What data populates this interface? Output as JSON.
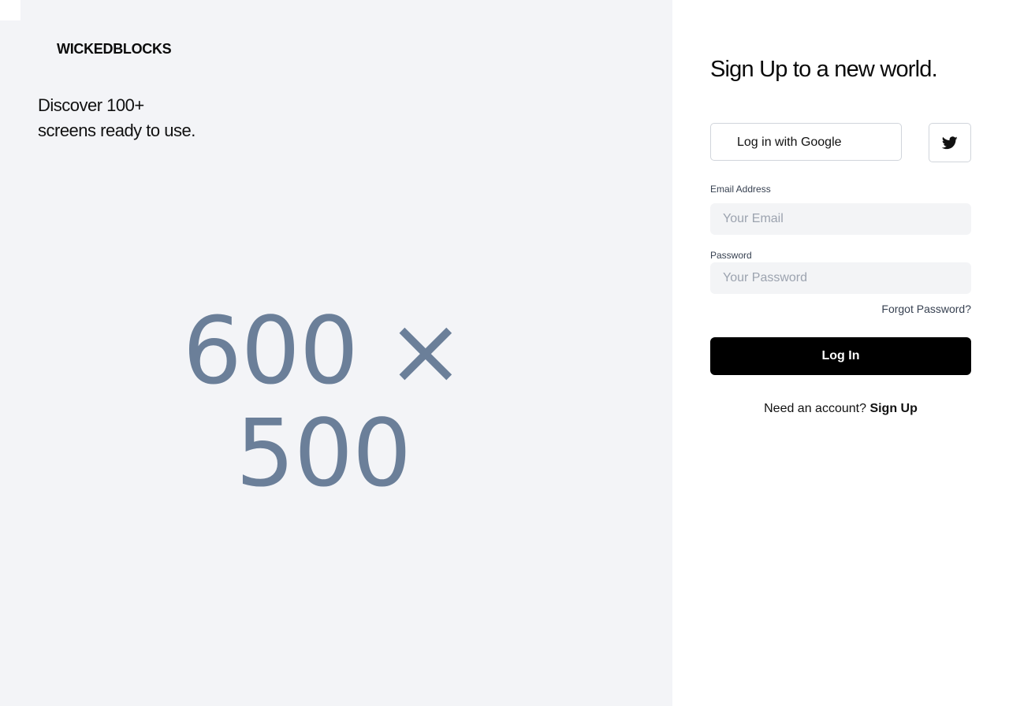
{
  "brand": {
    "name": "WICKEDBLOCKS"
  },
  "hero": {
    "line1": "Discover 100+",
    "line2": "screens ready to use.",
    "image_placeholder": "600 × 500"
  },
  "form": {
    "title": "Sign Up to a new world.",
    "google_button": "Log in with Google",
    "twitter_icon": "twitter-icon",
    "email_label": "Email Address",
    "email_placeholder": "Your Email",
    "email_value": "",
    "password_label": "Password",
    "password_placeholder": "Your Password",
    "password_value": "",
    "forgot_password": "Forgot Password?",
    "login_button": "Log In",
    "need_account": "Need an account?",
    "signup_link": "Sign Up"
  },
  "colors": {
    "left_panel_bg": "#f3f4f7",
    "input_bg": "#f3f4f6",
    "primary_button_bg": "#000000",
    "placeholder_image_text": "#6b7f99"
  }
}
